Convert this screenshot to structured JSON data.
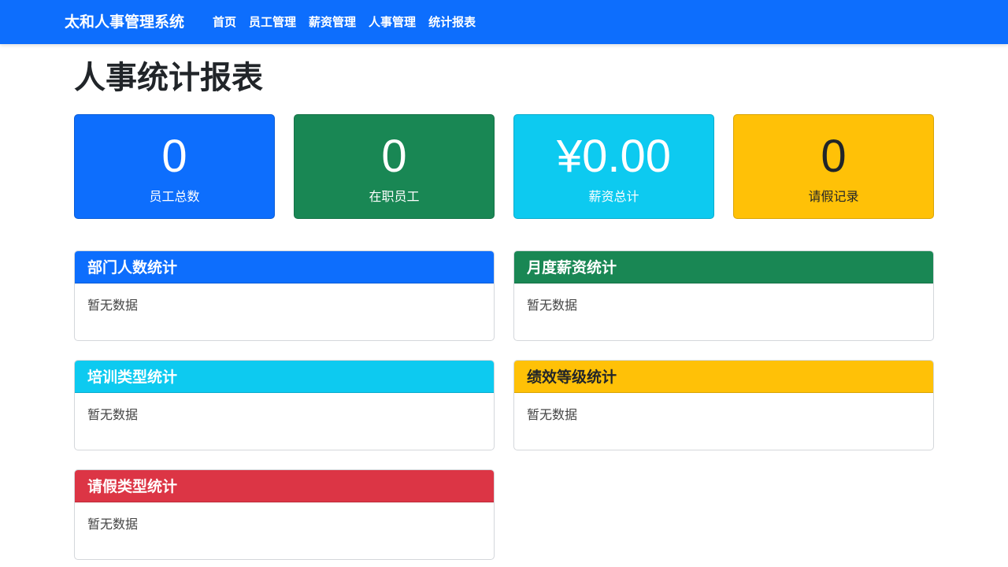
{
  "navbar": {
    "brand": "太和人事管理系统",
    "links": [
      {
        "label": "首页"
      },
      {
        "label": "员工管理"
      },
      {
        "label": "薪资管理"
      },
      {
        "label": "人事管理"
      },
      {
        "label": "统计报表"
      }
    ],
    "color": "#0d6efd"
  },
  "page": {
    "title": "人事统计报表"
  },
  "stats": [
    {
      "value": "0",
      "label": "员工总数",
      "bg": "#0d6efd",
      "fg": "#ffffff"
    },
    {
      "value": "0",
      "label": "在职员工",
      "bg": "#198754",
      "fg": "#ffffff"
    },
    {
      "value": "¥0.00",
      "label": "薪资总计",
      "bg": "#0dcaf0",
      "fg": "#ffffff"
    },
    {
      "value": "0",
      "label": "请假记录",
      "bg": "#ffc107",
      "fg": "#212529"
    }
  ],
  "panels": [
    {
      "title": "部门人数统计",
      "body": "暂无数据",
      "bg": "#0d6efd",
      "fg": "#ffffff"
    },
    {
      "title": "月度薪资统计",
      "body": "暂无数据",
      "bg": "#198754",
      "fg": "#ffffff"
    },
    {
      "title": "培训类型统计",
      "body": "暂无数据",
      "bg": "#0dcaf0",
      "fg": "#ffffff"
    },
    {
      "title": "绩效等级统计",
      "body": "暂无数据",
      "bg": "#ffc107",
      "fg": "#212529"
    },
    {
      "title": "请假类型统计",
      "body": "暂无数据",
      "bg": "#dc3545",
      "fg": "#ffffff"
    }
  ]
}
